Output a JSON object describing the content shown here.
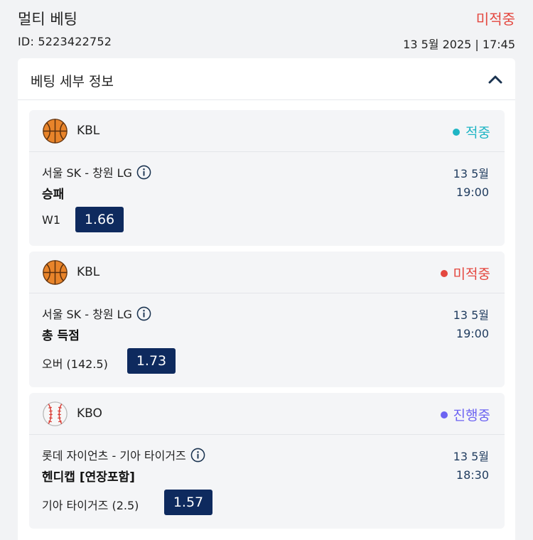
{
  "header": {
    "title": "멀티 베팅",
    "status": "미적중",
    "status_color": "#e4473f",
    "id_text": "ID: 5223422752",
    "datetime": "13 5월 2025 | 17:45"
  },
  "panel": {
    "title": "베팅 세부 정보",
    "collapse_icon": "chevron-up-icon"
  },
  "bets": [
    {
      "league": "KBL",
      "sport_icon": "basketball-icon",
      "status": "적중",
      "status_color": "#1fb5c4",
      "match": "서울 SK - 창원 LG",
      "market": "승패",
      "selection": "W1",
      "odds": "1.66",
      "date": "13 5월",
      "time": "19:00"
    },
    {
      "league": "KBL",
      "sport_icon": "basketball-icon",
      "status": "미적중",
      "status_color": "#e4473f",
      "match": "서울 SK - 창원 LG",
      "market": "총 득점",
      "selection": "오버 (142.5)",
      "odds": "1.73",
      "date": "13 5월",
      "time": "19:00"
    },
    {
      "league": "KBO",
      "sport_icon": "baseball-icon",
      "status": "진행중",
      "status_color": "#6c63f2",
      "match": "롯데 자이언츠 - 기아 타이거즈",
      "market": "헨디캡 [연장포함]",
      "selection": "기아 타이거즈 (2.5)",
      "odds": "1.57",
      "date": "13 5월",
      "time": "18:30"
    }
  ]
}
